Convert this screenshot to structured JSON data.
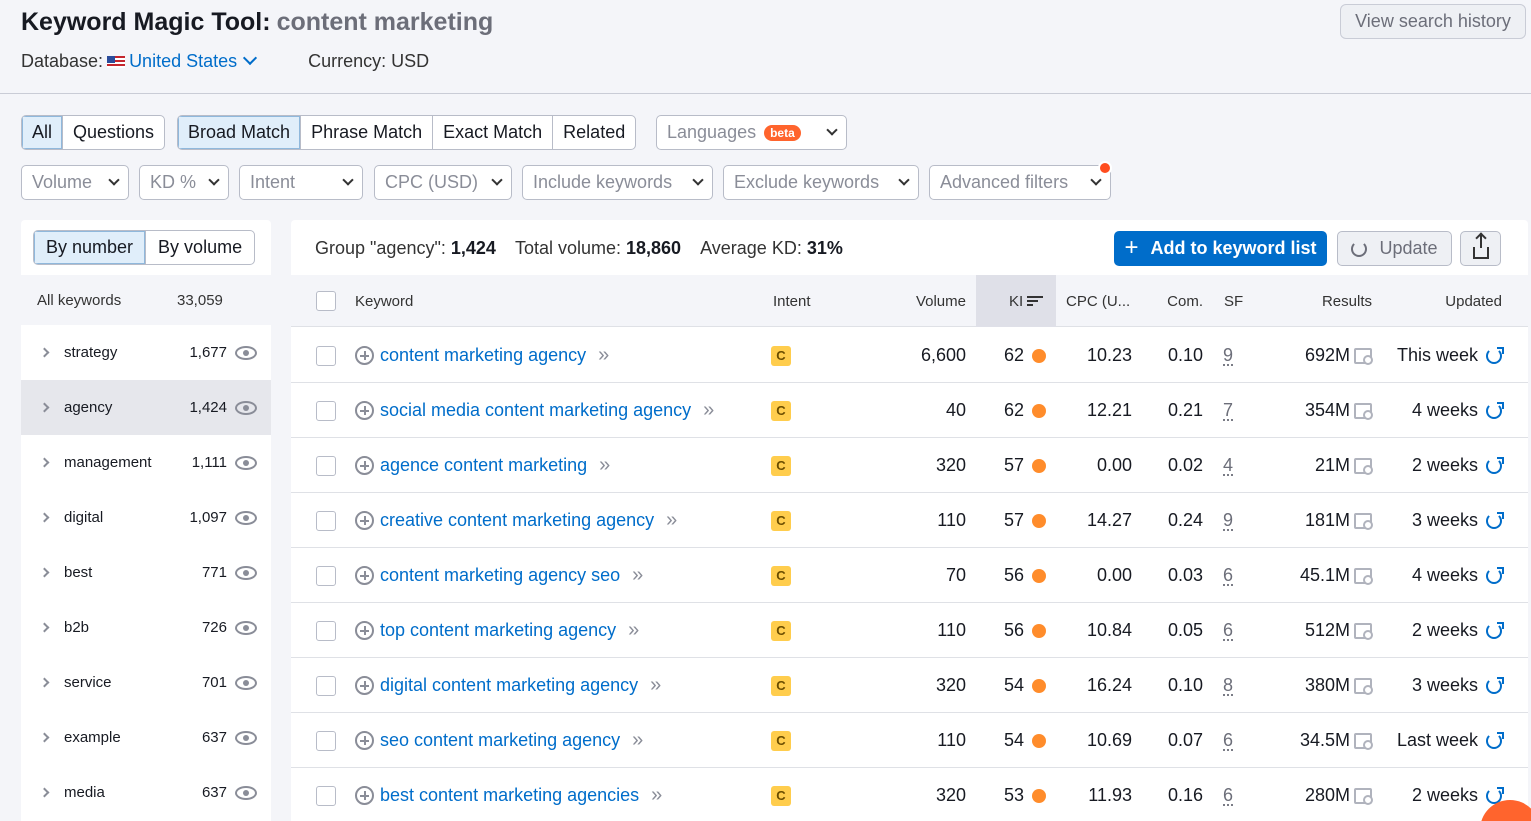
{
  "header": {
    "title": "Keyword Magic Tool:",
    "query": "content marketing",
    "database_label": "Database:",
    "country": "United States",
    "currency": "Currency: USD",
    "history_button": "View search history"
  },
  "match_tabs": {
    "all": "All",
    "questions": "Questions",
    "broad": "Broad Match",
    "phrase": "Phrase Match",
    "exact": "Exact Match",
    "related": "Related",
    "languages": "Languages",
    "beta": "beta"
  },
  "filters": {
    "volume": "Volume",
    "kd": "KD %",
    "intent": "Intent",
    "cpc": "CPC (USD)",
    "include": "Include keywords",
    "exclude": "Exclude keywords",
    "advanced": "Advanced filters"
  },
  "sidebar": {
    "by_number": "By number",
    "by_volume": "By volume",
    "all_label": "All keywords",
    "all_count": "33,059",
    "groups": [
      {
        "label": "strategy",
        "count": "1,677"
      },
      {
        "label": "agency",
        "count": "1,424"
      },
      {
        "label": "management",
        "count": "1,111"
      },
      {
        "label": "digital",
        "count": "1,097"
      },
      {
        "label": "best",
        "count": "771"
      },
      {
        "label": "b2b",
        "count": "726"
      },
      {
        "label": "service",
        "count": "701"
      },
      {
        "label": "example",
        "count": "637"
      },
      {
        "label": "media",
        "count": "637"
      }
    ]
  },
  "summary": {
    "group_label": "Group \"agency\":",
    "group_count": "1,424",
    "volume_label": "Total volume:",
    "volume_value": "18,860",
    "kd_label": "Average KD:",
    "kd_value": "31%",
    "add_button": "Add to keyword list",
    "update_button": "Update"
  },
  "table": {
    "headers": {
      "keyword": "Keyword",
      "intent": "Intent",
      "volume": "Volume",
      "kd": "KI",
      "cpc": "CPC (U...",
      "com": "Com.",
      "sf": "SF",
      "results": "Results",
      "updated": "Updated"
    },
    "rows": [
      {
        "keyword": "content marketing agency",
        "intent": "C",
        "volume": "6,600",
        "kd": "62",
        "cpc": "10.23",
        "com": "0.10",
        "sf": "9",
        "results": "692M",
        "updated": "This week"
      },
      {
        "keyword": "social media content marketing agency",
        "intent": "C",
        "volume": "40",
        "kd": "62",
        "cpc": "12.21",
        "com": "0.21",
        "sf": "7",
        "results": "354M",
        "updated": "4 weeks"
      },
      {
        "keyword": "agence content marketing",
        "intent": "C",
        "volume": "320",
        "kd": "57",
        "cpc": "0.00",
        "com": "0.02",
        "sf": "4",
        "results": "21M",
        "updated": "2 weeks"
      },
      {
        "keyword": "creative content marketing agency",
        "intent": "C",
        "volume": "110",
        "kd": "57",
        "cpc": "14.27",
        "com": "0.24",
        "sf": "9",
        "results": "181M",
        "updated": "3 weeks"
      },
      {
        "keyword": "content marketing agency seo",
        "intent": "C",
        "volume": "70",
        "kd": "56",
        "cpc": "0.00",
        "com": "0.03",
        "sf": "6",
        "results": "45.1M",
        "updated": "4 weeks"
      },
      {
        "keyword": "top content marketing agency",
        "intent": "C",
        "volume": "110",
        "kd": "56",
        "cpc": "10.84",
        "com": "0.05",
        "sf": "6",
        "results": "512M",
        "updated": "2 weeks"
      },
      {
        "keyword": "digital content marketing agency",
        "intent": "C",
        "volume": "320",
        "kd": "54",
        "cpc": "16.24",
        "com": "0.10",
        "sf": "8",
        "results": "380M",
        "updated": "3 weeks"
      },
      {
        "keyword": "seo content marketing agency",
        "intent": "C",
        "volume": "110",
        "kd": "54",
        "cpc": "10.69",
        "com": "0.07",
        "sf": "6",
        "results": "34.5M",
        "updated": "Last week"
      },
      {
        "keyword": "best content marketing agencies",
        "intent": "C",
        "volume": "320",
        "kd": "53",
        "cpc": "11.93",
        "com": "0.16",
        "sf": "6",
        "results": "280M",
        "updated": "2 weeks"
      }
    ]
  },
  "colors": {
    "accent": "#006dca",
    "kd_dot": "#ff8c2b",
    "intent_commercial": "#ffcd4d",
    "beta": "#ff642d"
  }
}
